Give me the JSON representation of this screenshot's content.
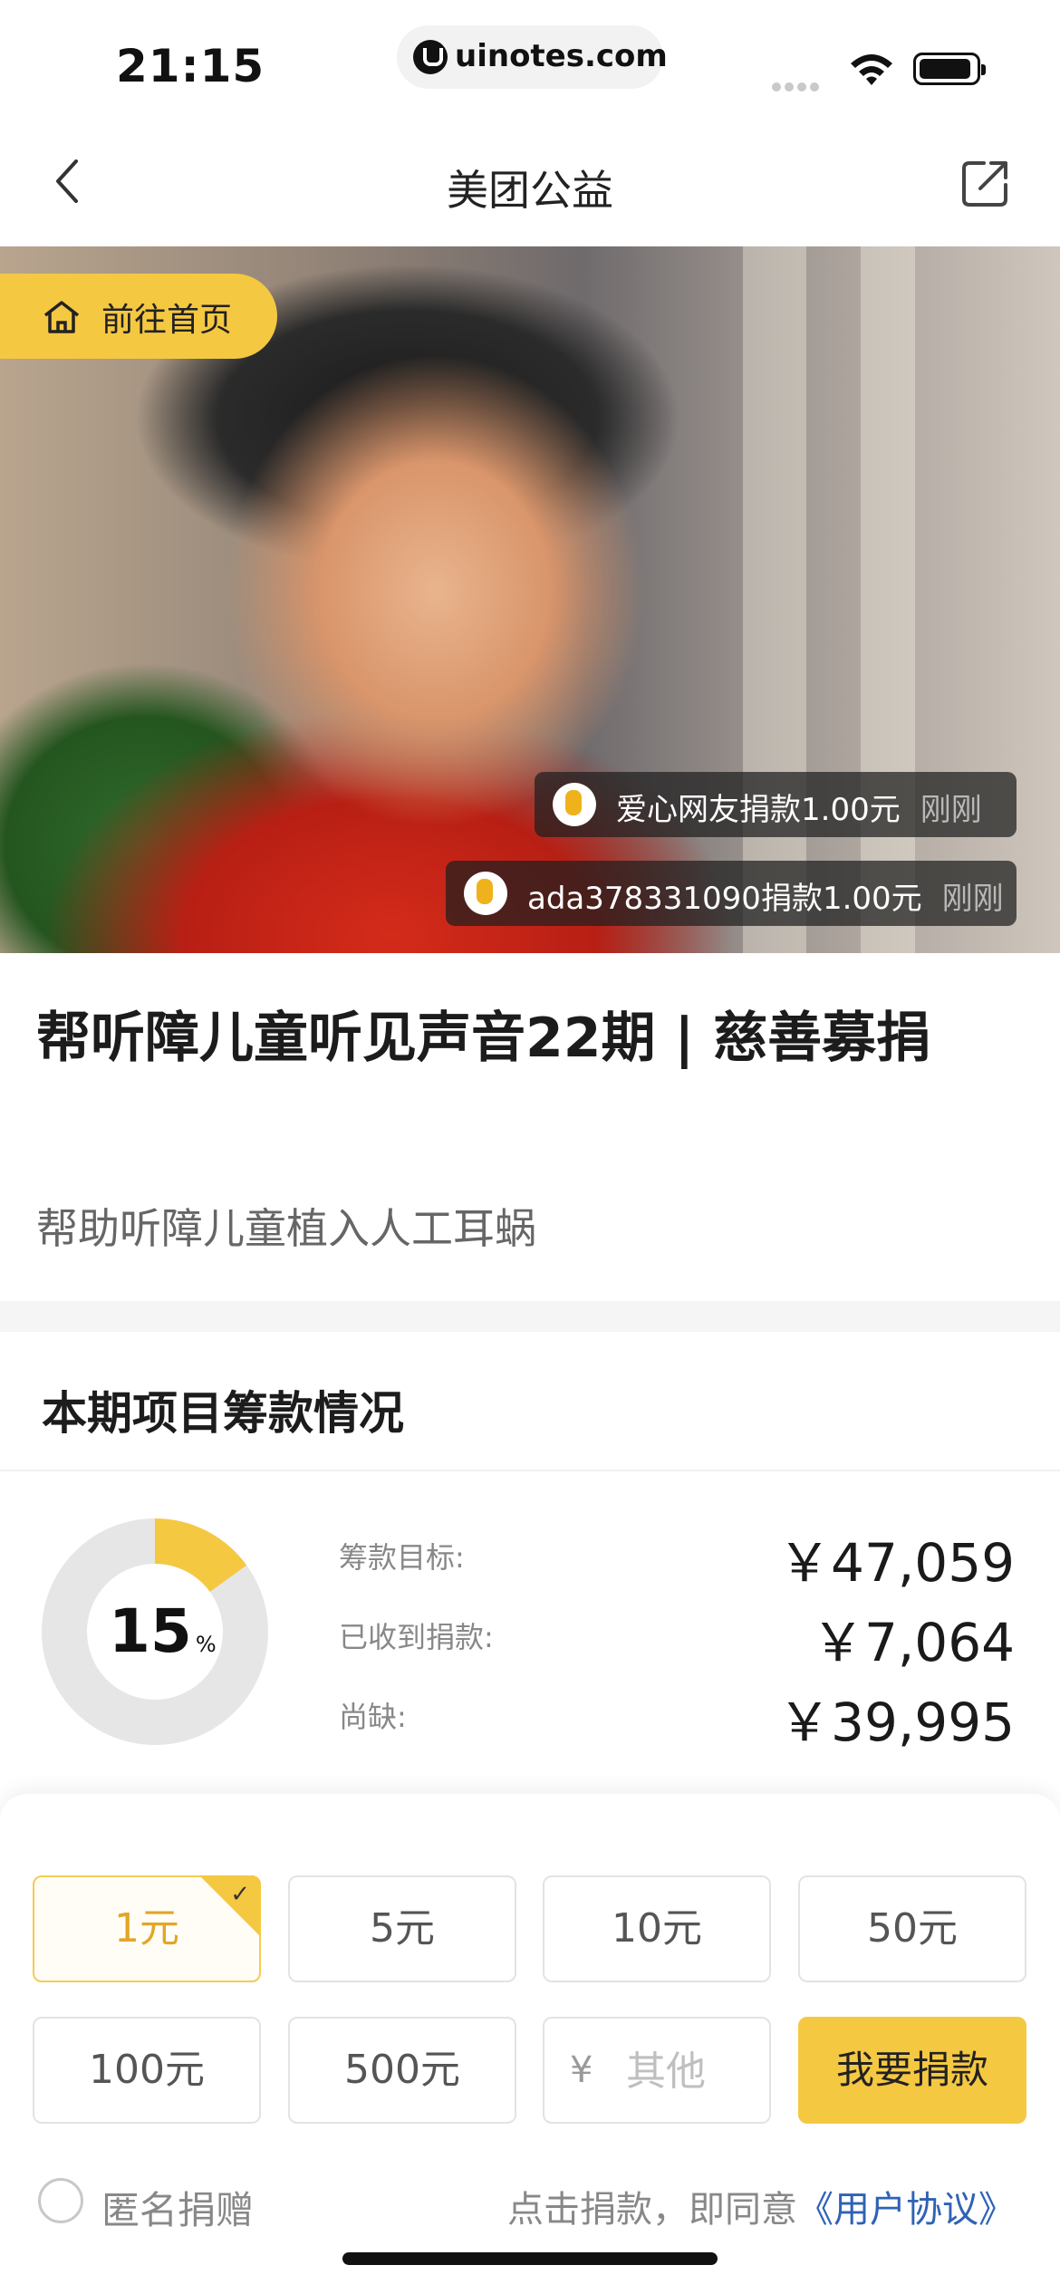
{
  "status_bar": {
    "time": "21:15",
    "url": "uinotes.com",
    "icons": [
      "signal-icon",
      "wifi-icon",
      "battery-icon"
    ]
  },
  "nav": {
    "title": "美团公益",
    "back_icon": "chevron-left-icon",
    "share_icon": "share-icon"
  },
  "hero": {
    "home_button_label": "前往首页",
    "toasts": [
      {
        "text": "爱心网友捐款1.00元",
        "time": "刚刚"
      },
      {
        "text": "ada378331090捐款1.00元",
        "time": "刚刚"
      }
    ]
  },
  "project": {
    "title": "帮听障儿童听见声音22期 | 慈善募捐",
    "subtitle": "帮助听障儿童植入人工耳蜗"
  },
  "funding": {
    "section_title": "本期项目筹款情况",
    "progress_value": "15",
    "progress_unit": "%",
    "progress_fraction": 0.15,
    "rows": [
      {
        "label": "筹款目标:",
        "value": "￥47,059"
      },
      {
        "label": "已收到捐款:",
        "value": "￥7,064"
      },
      {
        "label": "尚缺:",
        "value": "￥39,995"
      }
    ],
    "colors": {
      "progress": "#F5C842",
      "track": "#E6E6E6"
    }
  },
  "donation": {
    "amounts": [
      "1元",
      "5元",
      "10元",
      "50元",
      "100元",
      "500元"
    ],
    "selected_index": 0,
    "other_prefix": "¥",
    "other_placeholder": "其他",
    "submit_label": "我要捐款",
    "anonymous_label": "匿名捐赠",
    "agreement_prefix": "点击捐款，即同意",
    "agreement_link": "《用户协议》",
    "accent_color": "#F5C842"
  }
}
